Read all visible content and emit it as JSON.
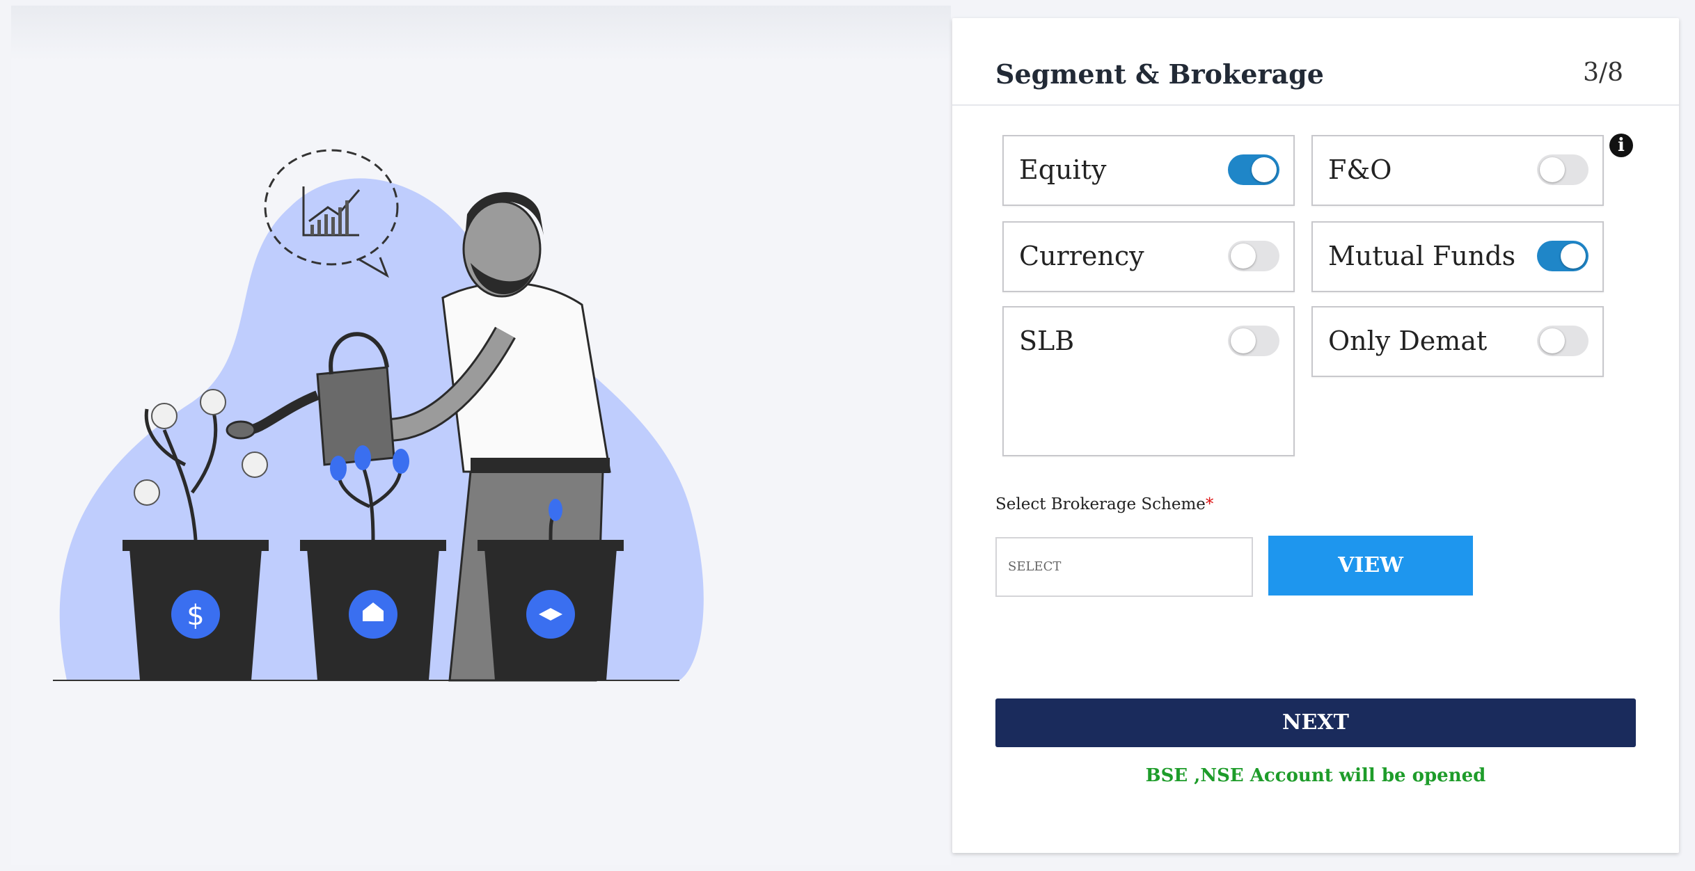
{
  "header": {
    "title": "Segment & Brokerage",
    "step": "3/8"
  },
  "segments": [
    {
      "label": "Equity",
      "enabled": true
    },
    {
      "label": "F&O",
      "enabled": false
    },
    {
      "label": "Currency",
      "enabled": false
    },
    {
      "label": "Mutual Funds",
      "enabled": true
    },
    {
      "label": "SLB",
      "enabled": false
    },
    {
      "label": "Only Demat",
      "enabled": false
    }
  ],
  "brokerage": {
    "label": "Select Brokerage Scheme",
    "required_mark": "*",
    "select_placeholder": "SELECT",
    "view_label": "VIEW"
  },
  "next_label": "NEXT",
  "account_note": "BSE ,NSE Account will be opened",
  "info_icon_glyph": "i",
  "colors": {
    "toggle_on": "#1f86c8",
    "view_button": "#1e96ee",
    "next_button": "#1a2b5c",
    "note_green": "#1e9c2a"
  }
}
